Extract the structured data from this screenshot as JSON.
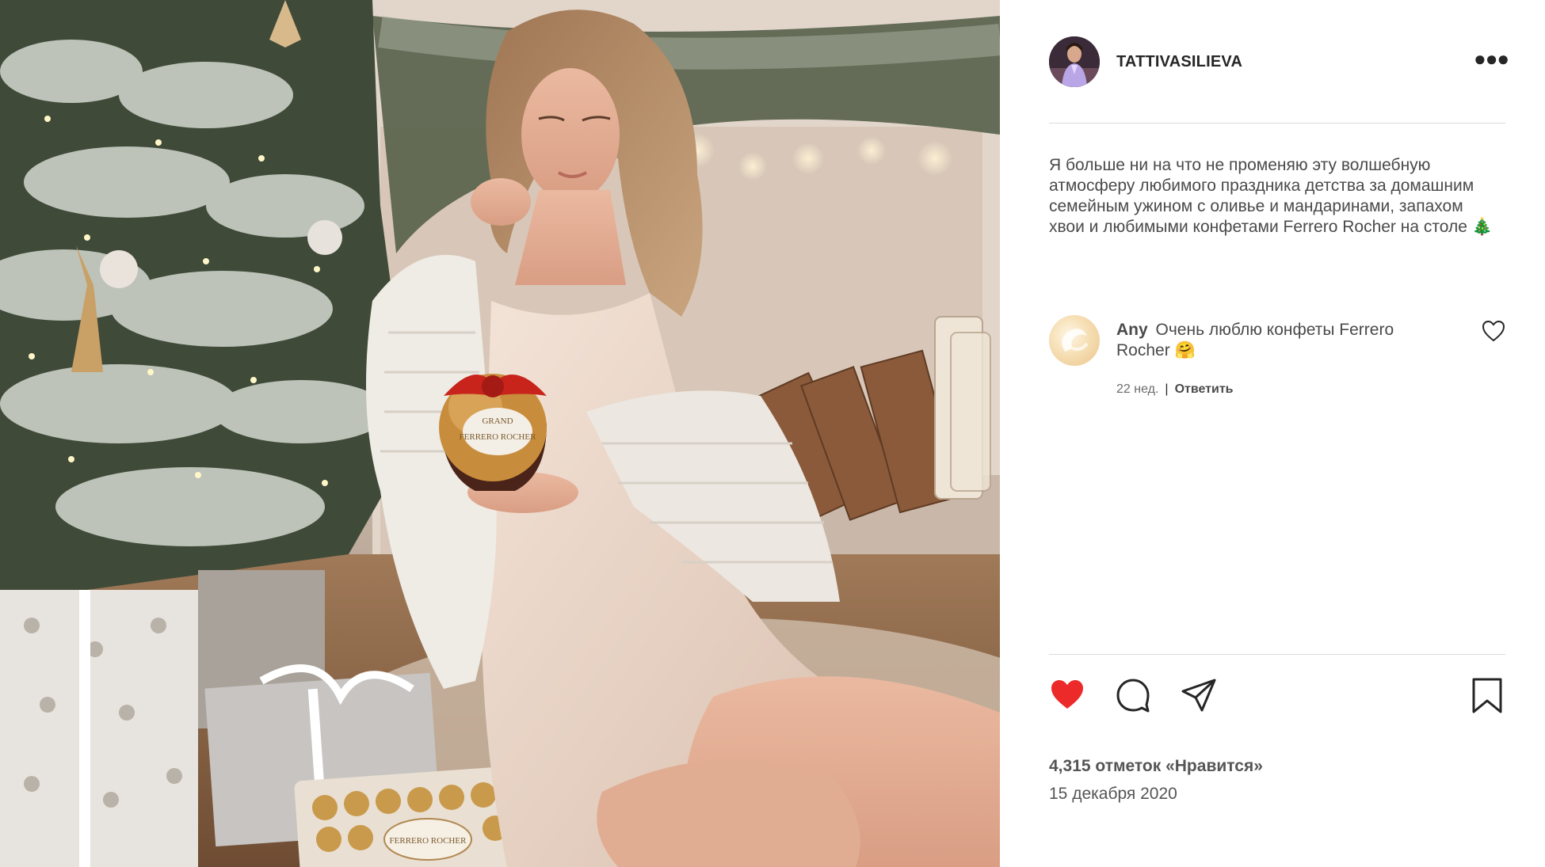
{
  "post": {
    "username": "TATTIVASILIEVA",
    "more_icon": "more-horizontal-icon",
    "caption": "Я больше ни на что не променяю эту волшебную атмосферу любимого праздника детства за домашним семейным ужином с оливье и мандаринами, запахом хвои и любимыми конфетами Ferrero Rocher на столе 🎄",
    "comment": {
      "author": "Any",
      "text": "Очень люблю конфеты Ferrero Rocher 🤗",
      "age": "22 нед.",
      "separator": "|",
      "reply_label": "Ответить"
    },
    "likes": "4,315 отметок «Нравится»",
    "date": "15 декабря 2020",
    "liked": true
  },
  "photo": {
    "box_text_top": "GRAND",
    "box_text_brand": "FERRERO ROCHER",
    "tray_text": "FERRERO ROCHER"
  },
  "colors": {
    "like_active": "#ed2a2a",
    "text_primary": "#262626",
    "divider": "#dbdbdb"
  },
  "icons": [
    "heart-filled-icon",
    "comment-icon",
    "share-icon",
    "bookmark-icon",
    "heart-outline-icon"
  ]
}
